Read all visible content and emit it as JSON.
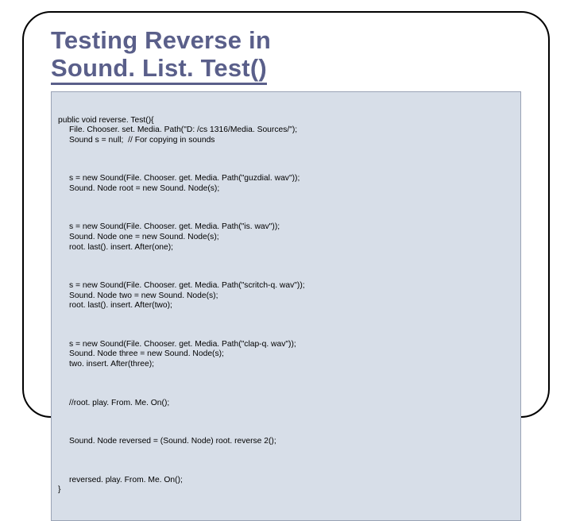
{
  "title_line1": "Testing Reverse in",
  "title_line2": "Sound. List. Test()",
  "code": {
    "b1": {
      "l1": "public void reverse. Test(){",
      "l2": "File. Chooser. set. Media. Path(\"D: /cs 1316/Media. Sources/\");",
      "l3": "Sound s = null;  // For copying in sounds"
    },
    "b2": {
      "l1": "s = new Sound(File. Chooser. get. Media. Path(\"guzdial. wav\"));",
      "l2": "Sound. Node root = new Sound. Node(s);"
    },
    "b3": {
      "l1": "s = new Sound(File. Chooser. get. Media. Path(\"is. wav\"));",
      "l2": "Sound. Node one = new Sound. Node(s);",
      "l3": "root. last(). insert. After(one);"
    },
    "b4": {
      "l1": "s = new Sound(File. Chooser. get. Media. Path(\"scritch-q. wav\"));",
      "l2": "Sound. Node two = new Sound. Node(s);",
      "l3": "root. last(). insert. After(two);"
    },
    "b5": {
      "l1": "s = new Sound(File. Chooser. get. Media. Path(\"clap-q. wav\"));",
      "l2": "Sound. Node three = new Sound. Node(s);",
      "l3": "two. insert. After(three);"
    },
    "b6": {
      "l1": "//root. play. From. Me. On();"
    },
    "b7": {
      "l1": "Sound. Node reversed = (Sound. Node) root. reverse 2();"
    },
    "b8": {
      "l1": "reversed. play. From. Me. On();",
      "l2": "}"
    }
  }
}
